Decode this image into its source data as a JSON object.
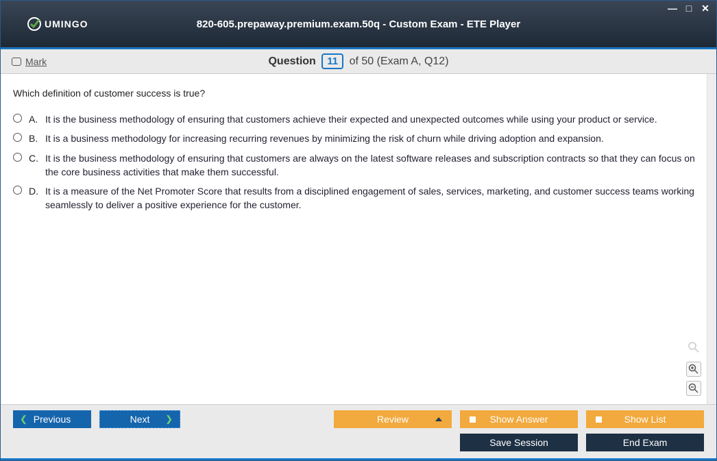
{
  "header": {
    "logo": "UMINGO",
    "title": "820-605.prepaway.premium.exam.50q - Custom Exam - ETE Player"
  },
  "qbar": {
    "mark": "Mark",
    "question_label": "Question",
    "current": "11",
    "rest": " of 50 (Exam A, Q12)"
  },
  "question": {
    "stem": "Which definition of customer success is true?",
    "options": [
      {
        "letter": "A.",
        "text": "It is the business methodology of ensuring that customers achieve their expected and unexpected outcomes while using your product or service."
      },
      {
        "letter": "B.",
        "text": "It is a business methodology for increasing recurring revenues by minimizing the risk of churn while driving adoption and expansion."
      },
      {
        "letter": "C.",
        "text": "It is the business methodology of ensuring that customers are always on the latest software releases and subscription contracts so that they can focus on the core business activities that make them successful."
      },
      {
        "letter": "D.",
        "text": "It is a measure of the Net Promoter Score that results from a disciplined engagement of sales, services, marketing, and customer success teams working seamlessly to deliver a positive experience for the customer."
      }
    ]
  },
  "footer": {
    "previous": "Previous",
    "next": "Next",
    "review": "Review",
    "show_answer": "Show Answer",
    "show_list": "Show List",
    "save_session": "Save Session",
    "end_exam": "End Exam"
  }
}
